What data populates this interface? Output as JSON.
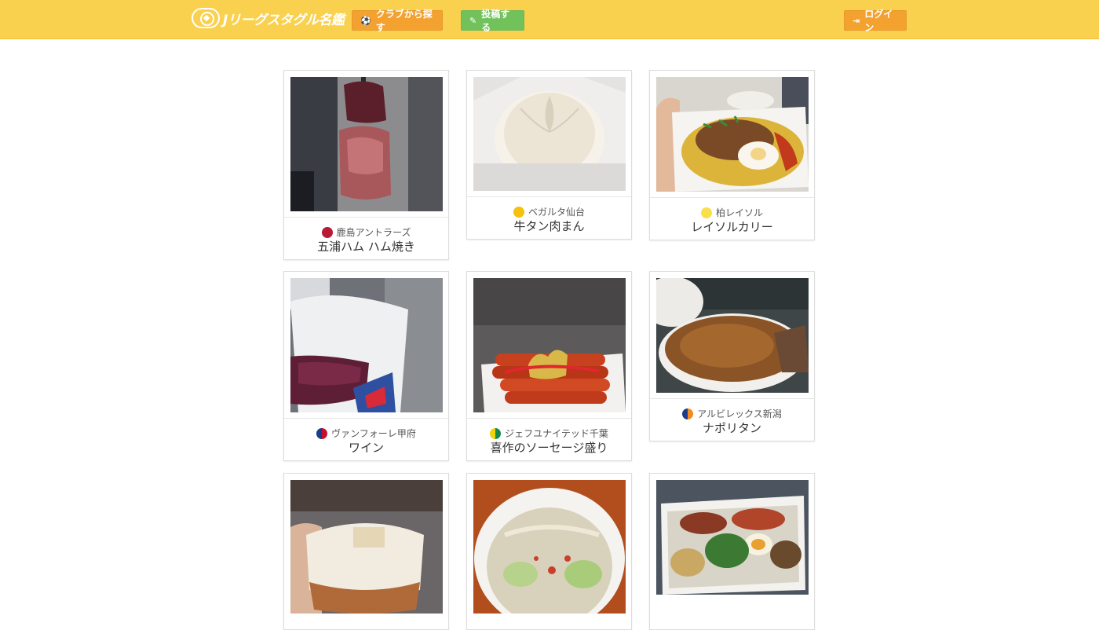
{
  "navbar": {
    "logo_text": "Jリーグスタグル名鑑",
    "club_search_label": "クラブから探す",
    "post_label": "投稿する",
    "login_label": "ログイン",
    "colors": {
      "bar": "#f9d14f",
      "orange": "#f4a22f",
      "green": "#72c25c"
    }
  },
  "cards": [
    {
      "club": "鹿島アントラーズ",
      "food": "五浦ハム ハム焼き",
      "club_colors": [
        "#b81a35",
        "#b81a35"
      ]
    },
    {
      "club": "ベガルタ仙台",
      "food": "牛タン肉まん",
      "club_colors": [
        "#f5c10c",
        "#f5c10c"
      ]
    },
    {
      "club": "柏レイソル",
      "food": "レイソルカリー",
      "club_colors": [
        "#f9e04b",
        "#f9e04b"
      ]
    },
    {
      "club": "ヴァンフォーレ甲府",
      "food": "ワイン",
      "club_colors": [
        "#1b3c8c",
        "#c8102e"
      ]
    },
    {
      "club": "ジェフユナイテッド千葉",
      "food": "喜作のソーセージ盛り",
      "club_colors": [
        "#f2d20a",
        "#14894e"
      ]
    },
    {
      "club": "アルビレックス新潟",
      "food": "ナポリタン",
      "club_colors": [
        "#1b3c8c",
        "#f28a1f"
      ]
    },
    {
      "club": "",
      "food": ""
    },
    {
      "club": "",
      "food": ""
    },
    {
      "club": "",
      "food": ""
    }
  ]
}
